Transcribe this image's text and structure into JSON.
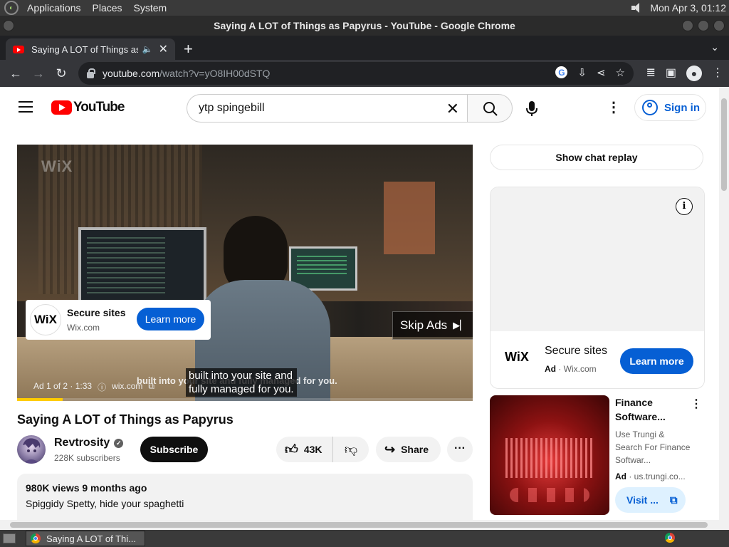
{
  "desktop": {
    "menus": [
      "Applications",
      "Places",
      "System"
    ],
    "clock": "Mon Apr  3, 01:12"
  },
  "window": {
    "title": "Saying A LOT of Things as Papyrus - YouTube - Google Chrome"
  },
  "browser": {
    "tab_title": "Saying A LOT of Things as Papyrus - YouTube",
    "url_host": "youtube.com",
    "url_path": "/watch?v=yO8IH00dSTQ"
  },
  "youtube": {
    "logo_text": "YouTube",
    "search_value": "ytp spingebill",
    "sign_in": "Sign in",
    "player": {
      "watermark": "WiX",
      "ad_title": "Secure sites",
      "ad_domain": "Wix.com",
      "ad_cta": "Learn more",
      "skip_label": "Skip Ads",
      "caption_line1": "built into your site and",
      "caption_line2": "fully managed for you.",
      "ghost_caption": "built into your site and fully managed for you.",
      "ad_counter": "Ad 1 of 2 · 1:33",
      "ad_link": "wix.com",
      "progress": 0.1
    },
    "video": {
      "title": "Saying A LOT of Things as Papyrus",
      "channel": "Revtrosity",
      "subscribers": "228K subscribers",
      "subscribe": "Subscribe",
      "likes": "43K",
      "share": "Share",
      "views_date": "980K views  9 months ago",
      "description": "Spiggidy Spetty, hide your spaghetti"
    },
    "sidebar": {
      "chat_replay": "Show chat replay",
      "ad_logo": "WiX",
      "ad_title": "Secure sites",
      "ad_label": "Ad",
      "ad_domain": "Wix.com",
      "ad_cta": "Learn more",
      "rec_title": "Finance Software...",
      "rec_desc": "Use Trungi & Search For Finance Softwar...",
      "rec_ad_label": "Ad",
      "rec_domain": "us.trungi.co...",
      "rec_cta": "Visit ..."
    }
  },
  "taskbar": {
    "task_label": "Saying A LOT of Thi..."
  }
}
